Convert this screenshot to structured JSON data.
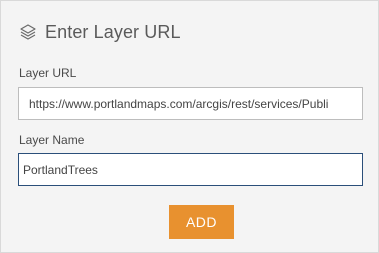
{
  "header": {
    "title": "Enter Layer URL",
    "icon": "layers-icon"
  },
  "form": {
    "url_label": "Layer URL",
    "url_value": "https://www.portlandmaps.com/arcgis/rest/services/Publi",
    "name_label": "Layer Name",
    "name_value": "PortlandTrees",
    "add_label": "ADD"
  },
  "colors": {
    "accent": "#e8912f",
    "focus_border": "#2b4f7a",
    "background": "#f4f4f4"
  }
}
